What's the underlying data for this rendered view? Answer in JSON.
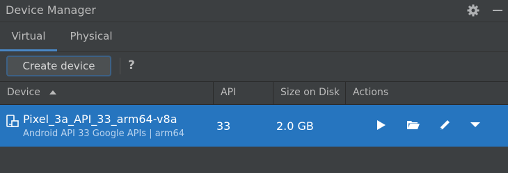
{
  "window": {
    "title": "Device Manager",
    "icons": {
      "settings": "gear-icon",
      "minimize": "minimize-icon"
    }
  },
  "tabs": [
    {
      "label": "Virtual",
      "selected": true
    },
    {
      "label": "Physical",
      "selected": false
    }
  ],
  "toolbar": {
    "create_label": "Create device",
    "help_label": "?"
  },
  "table": {
    "columns": [
      "Device",
      "API",
      "Size on Disk",
      "Actions"
    ],
    "sort": {
      "column": "Device",
      "direction": "ascending"
    },
    "rows": [
      {
        "name": "Pixel_3a_API_33_arm64-v8a",
        "subtitle": "Android API 33 Google APIs | arm64",
        "api": "33",
        "size": "2.0 GB",
        "selected": true,
        "actions": [
          "play-icon",
          "folder-icon",
          "edit-icon",
          "dropdown-arrow-icon"
        ]
      }
    ]
  },
  "colors": {
    "background": "#3c3f41",
    "selection": "#2675bf",
    "tab_indicator": "#4a88c7",
    "text": "#bbbbbb"
  }
}
